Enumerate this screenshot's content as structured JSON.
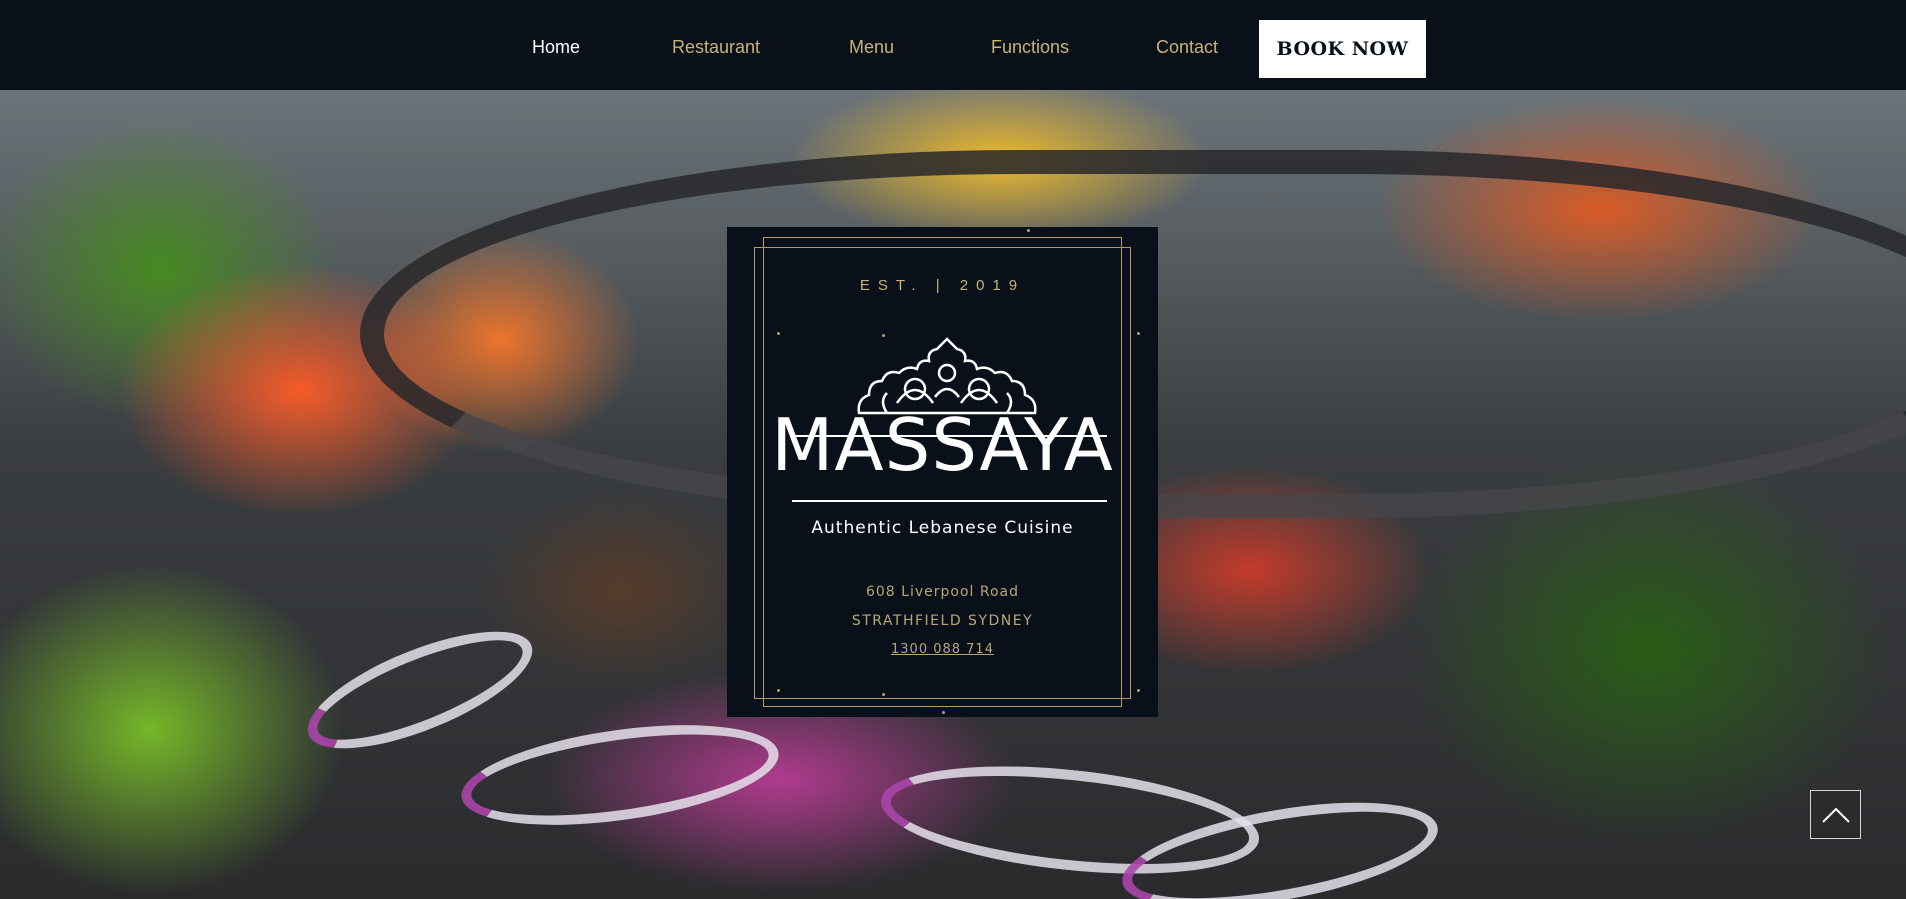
{
  "nav": {
    "items": [
      {
        "label": "Home",
        "active": true
      },
      {
        "label": "Restaurant",
        "active": false
      },
      {
        "label": "Menu",
        "active": false
      },
      {
        "label": "Functions",
        "active": false
      },
      {
        "label": "Contact",
        "active": false
      }
    ],
    "book_label": "BOOK NOW"
  },
  "card": {
    "est": "EST. | 2019",
    "brand": "MASSAYA",
    "tagline": "Authentic Lebanese Cuisine",
    "address_line1": "608 Liverpool Road",
    "address_line2": "STRATHFIELD SYDNEY",
    "phone": "1300 088 714"
  },
  "colors": {
    "nav_bg": "#0a1019",
    "accent_gold": "#c9b27a",
    "button_bg": "#ffffff",
    "card_bg": "#0a1019"
  },
  "icons": {
    "back_to_top": "chevron-up-icon",
    "logo_ornament": "ornament-crest-icon"
  }
}
